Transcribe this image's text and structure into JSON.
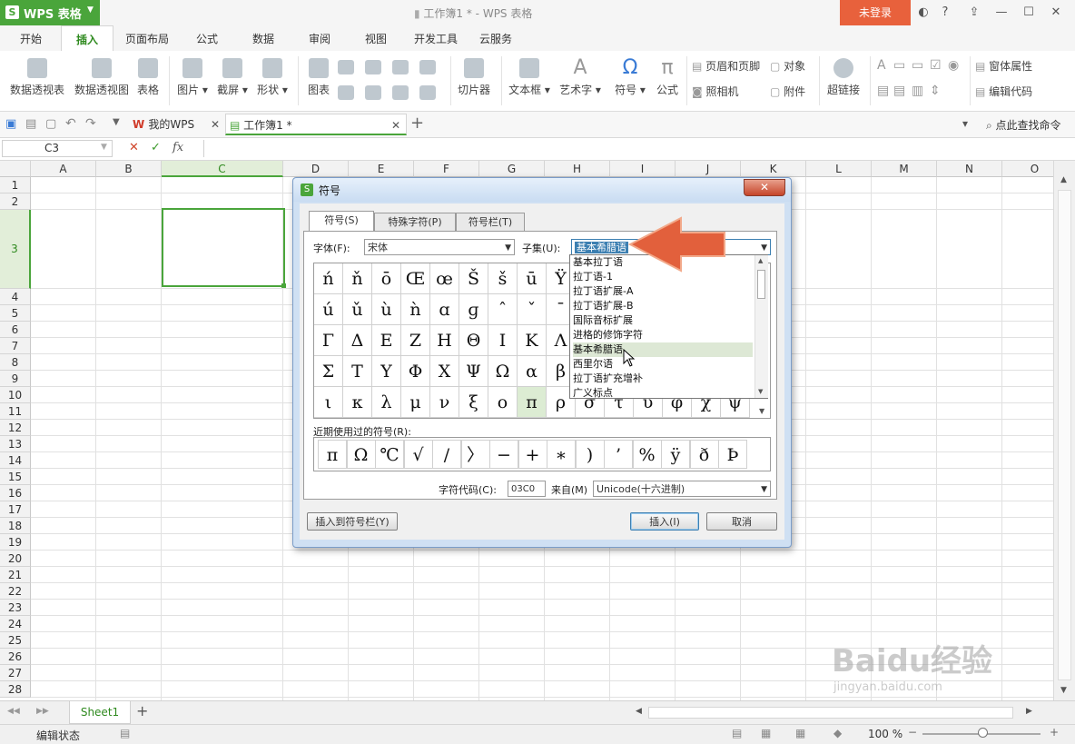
{
  "app": {
    "name": "WPS 表格",
    "window_title": "工作簿1 * - WPS 表格",
    "login_label": "未登录"
  },
  "ribbon_tabs": [
    "开始",
    "插入",
    "页面布局",
    "公式",
    "数据",
    "审阅",
    "视图",
    "开发工具",
    "云服务"
  ],
  "active_tab": "插入",
  "ribbon": {
    "pivot_table": "数据透视表",
    "pivot_chart": "数据透视图",
    "table": "表格",
    "picture": "图片",
    "screenshot": "截屏",
    "shape": "形状",
    "chart": "图表",
    "slicer": "切片器",
    "textbox": "文本框",
    "wordart": "艺术字",
    "symbol": "符号",
    "formula": "公式",
    "header_footer": "页眉和页脚",
    "object": "对象",
    "camera": "照相机",
    "attachment": "附件",
    "hyperlink": "超链接",
    "form_props": "窗体属性",
    "edit_code": "编辑代码"
  },
  "doc_tabs": {
    "mywps": "我的WPS",
    "workbook": "工作簿1 *",
    "search_cmd": "点此查找命令"
  },
  "formula_bar": {
    "cell_ref": "C3",
    "fx": "fx",
    "cancel": "✕",
    "confirm": "✓"
  },
  "columns": [
    "A",
    "B",
    "C",
    "D",
    "E",
    "F",
    "G",
    "H",
    "I",
    "J",
    "K",
    "L",
    "M",
    "N",
    "O"
  ],
  "rows": [
    "1",
    "2",
    "3",
    "4",
    "5",
    "6",
    "7",
    "8",
    "9",
    "10",
    "11",
    "12",
    "13",
    "14",
    "15",
    "16",
    "17",
    "18",
    "19",
    "20",
    "21",
    "22",
    "23",
    "24",
    "25",
    "26",
    "27",
    "28"
  ],
  "sheet_tab": "Sheet1",
  "add_sheet": "+",
  "status": {
    "mode": "编辑状态",
    "zoom": "100 %"
  },
  "dialog": {
    "title": "符号",
    "close": "✕",
    "tabs": [
      "符号(S)",
      "特殊字符(P)",
      "符号栏(T)"
    ],
    "font_label": "字体(F):",
    "font_value": "宋体",
    "subset_label": "子集(U):",
    "subset_value": "基本希腊语",
    "symbols": [
      [
        "ń",
        "ň",
        "ō",
        "Œ",
        "œ",
        "Š",
        "š",
        "ū",
        "Ÿ"
      ],
      [
        "ú",
        "ǔ",
        "ù",
        "ǹ",
        "ɑ",
        "ɡ",
        "ˆ",
        "ˇ",
        "ˉ"
      ],
      [
        "Γ",
        "Δ",
        "Ε",
        "Ζ",
        "Η",
        "Θ",
        "Ι",
        "Κ",
        "Λ"
      ],
      [
        "Σ",
        "Τ",
        "Υ",
        "Φ",
        "Χ",
        "Ψ",
        "Ω",
        "α",
        "β"
      ],
      [
        "ι",
        "κ",
        "λ",
        "μ",
        "ν",
        "ξ",
        "ο",
        "π",
        "ρ",
        "σ",
        "τ",
        "υ",
        "φ",
        "χ",
        "ψ"
      ]
    ],
    "selected_symbol": "π",
    "subset_options": [
      "基本拉丁语",
      "拉丁语-1",
      "拉丁语扩展-A",
      "拉丁语扩展-B",
      "国际音标扩展",
      "进格的修饰字符",
      "基本希腊语",
      "西里尔语",
      "拉丁语扩充增补",
      "广义标点"
    ],
    "recent_label": "近期使用过的符号(R):",
    "recent": [
      "π",
      "Ω",
      "℃",
      "√",
      "/",
      "〉",
      "−",
      "+",
      "∗",
      ")",
      "’",
      "%",
      "ÿ",
      "ð",
      "Þ"
    ],
    "char_code_label": "字符代码(C):",
    "char_code": "03C0",
    "from_label": "来自(M)",
    "from_value": "Unicode(十六进制)",
    "insert_toolbar_btn": "插入到符号栏(Y)",
    "insert_btn": "插入(I)",
    "cancel_btn": "取消"
  },
  "watermark": {
    "brand": "Baidu经验",
    "url": "jingyan.baidu.com"
  }
}
